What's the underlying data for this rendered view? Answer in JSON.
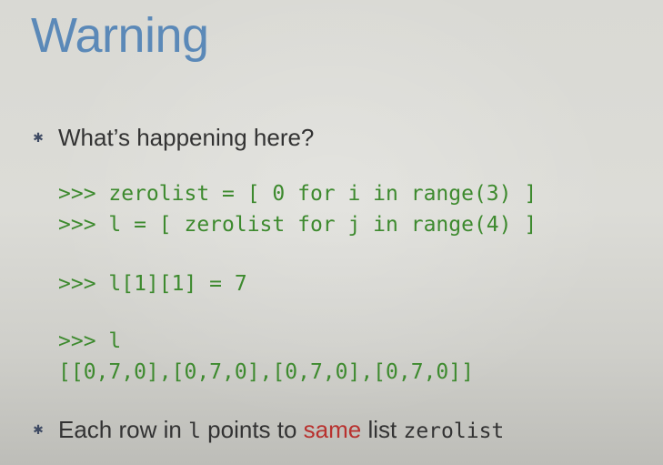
{
  "slide": {
    "title": "Warning",
    "bullets": [
      {
        "text": "What’s happening here?"
      },
      {
        "prefix": "Each row in ",
        "code_var": "l",
        "middle": " points to ",
        "emphasis": "same",
        "suffix": " list ",
        "code_list": "zerolist"
      }
    ],
    "bullet_marker": "✱",
    "code_lines": [
      ">>> zerolist = [ 0 for i in range(3) ]",
      ">>> l = [ zerolist for j in range(4) ]",
      ">>> l[1][1] = 7",
      ">>> l",
      "[[0,7,0],[0,7,0],[0,7,0],[0,7,0]]"
    ],
    "colors": {
      "title": "#5b89b8",
      "code": "#3d8a2e",
      "emphasis": "#b8322f",
      "text": "#333333"
    }
  }
}
